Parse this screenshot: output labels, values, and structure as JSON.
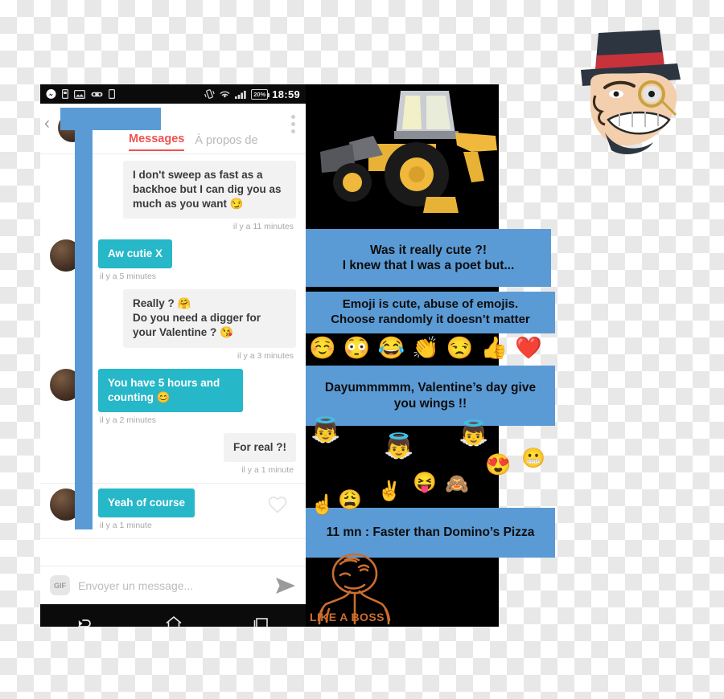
{
  "statusbar": {
    "icons": [
      "messenger-icon",
      "sim-card-icon",
      "photo-icon",
      "gamepad-icon",
      "phone-icon"
    ],
    "vibrate_icon": "vibrate-icon",
    "wifi_icon": "wifi-icon",
    "signal_icon": "cellular-signal-icon",
    "battery_text": "20%",
    "time": "18:59"
  },
  "header": {
    "back_label": "‹",
    "contact_name_redacted": "",
    "overflow_label": "more-options",
    "tabs": [
      {
        "label": "Messages",
        "active": true
      },
      {
        "label": "À propos de",
        "active": false
      }
    ]
  },
  "thread": {
    "messages": [
      {
        "direction": "in",
        "text": "I don't sweep as fast as a backhoe but I can dig you as much as you want 😏",
        "time": "il y a 11 minutes"
      },
      {
        "direction": "out",
        "text": "Aw cutie X",
        "time": "il y a 5 minutes"
      },
      {
        "direction": "in",
        "text": "Really ? 🤗\nDo you need a digger for your Valentine ? 😘",
        "time": "il y a 3 minutes"
      },
      {
        "direction": "out",
        "text": "You have 5 hours and counting 😊",
        "time": "il y a 2 minutes"
      },
      {
        "direction": "in",
        "text": "For real ?!",
        "time": "il y a 1 minute"
      },
      {
        "direction": "out",
        "text": "Yeah of course",
        "time": "il y a 1 minute",
        "reaction_icon": "heart-outline-icon"
      }
    ]
  },
  "composer": {
    "gif_label": "GIF",
    "placeholder": "Envoyer un message...",
    "send_icon": "send-arrow-icon"
  },
  "navbar": {
    "back_icon": "android-back-icon",
    "home_icon": "android-home-icon",
    "recents_icon": "android-recents-icon"
  },
  "annotations": {
    "banners": [
      {
        "id": "banner-1",
        "line1": "Was it really cute ?!",
        "line2": "I knew that I was a poet but..."
      },
      {
        "id": "banner-2",
        "line1": "Emoji is cute, abuse of emojis.",
        "line2": "Choose randomly it doesn’t matter"
      },
      {
        "id": "banner-3",
        "line1": "Dayummmmm, Valentine’s day give",
        "line2": "you wings !!"
      },
      {
        "id": "banner-4",
        "line1": "11 mn : Faster than Domino’s Pizza",
        "line2": ""
      }
    ],
    "emoji_strip": [
      "☺️",
      "😳",
      "😂",
      "👏",
      "😒",
      "👍",
      "❤️"
    ],
    "floating_emojis": [
      "👼",
      "👼",
      "👼",
      "😝",
      "🙈",
      "😍",
      "😬",
      "😩",
      "✌️",
      "☝️"
    ],
    "boss_caption": "LIKE A BOSS",
    "backhoe_image": "backhoe-loader-photo",
    "troll_image": "top-hat-villain-face"
  },
  "colors": {
    "banner_blue": "#5b9bd5",
    "censor_blue": "#5b9bd5",
    "outgoing_teal": "#26b7c9",
    "incoming_gray": "#f2f2f2",
    "tab_accent": "#ef5350",
    "boss_orange": "#cc6d2e"
  }
}
